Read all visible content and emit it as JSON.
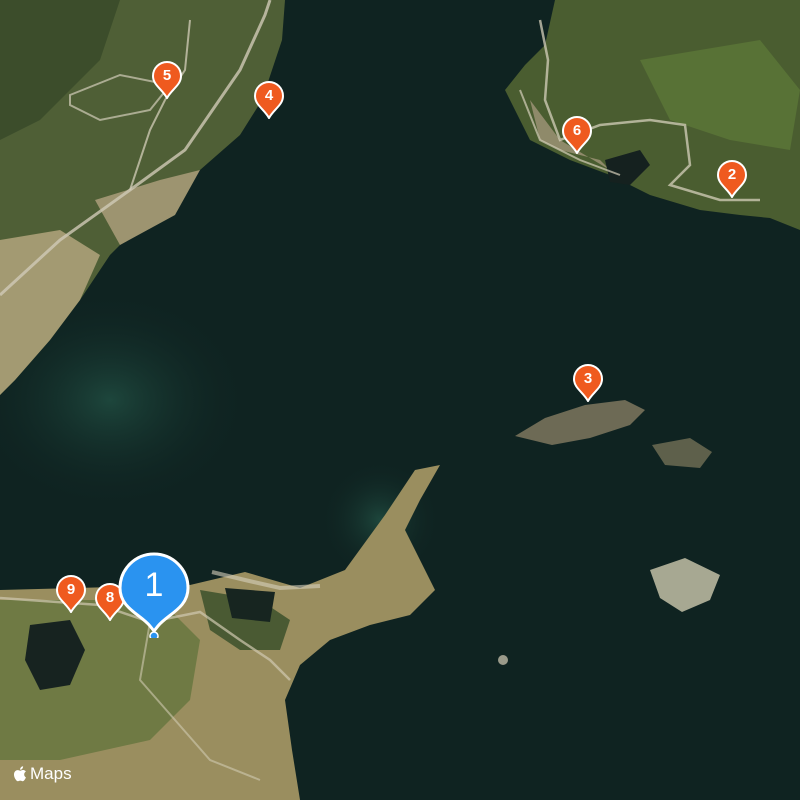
{
  "map": {
    "type": "satellite",
    "colors": {
      "water": "#0f2321",
      "land": "#5c6e3c",
      "pin_fill": "#ef5a1f",
      "current_location": "#2a93f0"
    }
  },
  "markers": [
    {
      "label": "1",
      "kind": "primary"
    },
    {
      "label": "2",
      "kind": "secondary"
    },
    {
      "label": "3",
      "kind": "secondary"
    },
    {
      "label": "4",
      "kind": "secondary"
    },
    {
      "label": "5",
      "kind": "secondary"
    },
    {
      "label": "6",
      "kind": "secondary"
    },
    {
      "label": "8",
      "kind": "secondary"
    },
    {
      "label": "9",
      "kind": "secondary"
    }
  ],
  "attribution": {
    "logo": "apple-logo-icon",
    "text": "Maps"
  }
}
